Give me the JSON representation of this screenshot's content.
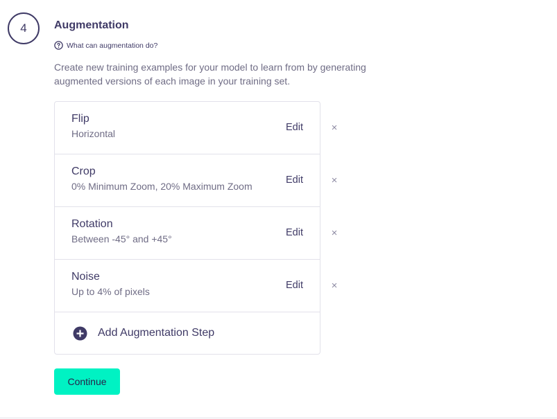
{
  "step": {
    "number": "4",
    "title": "Augmentation",
    "help_text": "What can augmentation do?",
    "help_icon": "question-circle-icon",
    "description": "Create new training examples for your model to learn from by generating augmented versions of each image in your training set."
  },
  "augmentations": [
    {
      "name": "Flip",
      "detail": "Horizontal",
      "edit_label": "Edit",
      "remove_icon": "×"
    },
    {
      "name": "Crop",
      "detail": "0% Minimum Zoom, 20% Maximum Zoom",
      "edit_label": "Edit",
      "remove_icon": "×"
    },
    {
      "name": "Rotation",
      "detail": "Between -45° and +45°",
      "edit_label": "Edit",
      "remove_icon": "×"
    },
    {
      "name": "Noise",
      "detail": "Up to 4% of pixels",
      "edit_label": "Edit",
      "remove_icon": "×"
    }
  ],
  "add_step": {
    "label": "Add Augmentation Step",
    "icon": "plus-circle-icon"
  },
  "continue_label": "Continue",
  "colors": {
    "accent": "#00f2c3",
    "primary_text": "#3f3a66",
    "secondary_text": "#6f6c85",
    "border": "#e2e1ea"
  }
}
